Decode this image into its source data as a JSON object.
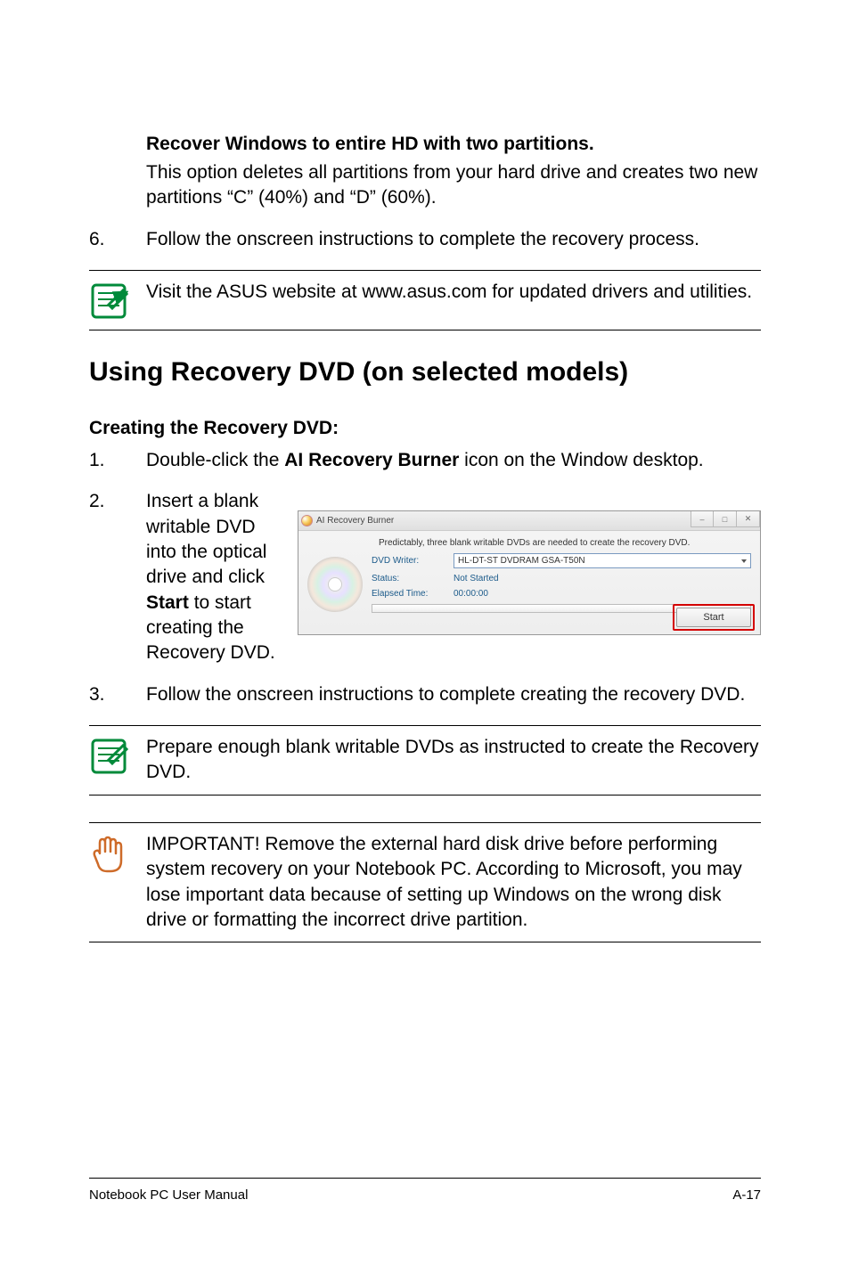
{
  "section1": {
    "heading": "Recover Windows to entire HD with two partitions.",
    "body": "This option deletes all partitions from your hard drive and creates two new partitions “C” (40%) and “D” (60%)."
  },
  "step6": {
    "num": "6.",
    "text": "Follow the onscreen instructions to complete the recovery process."
  },
  "note1": {
    "text": "Visit the ASUS website at www.asus.com for updated drivers and utilities."
  },
  "h2": "Using Recovery DVD (on selected models)",
  "h3": "Creating the Recovery DVD:",
  "step1": {
    "num": "1.",
    "pre": "Double-click the ",
    "bold": "AI Recovery Burner",
    "post": " icon on the Window desktop."
  },
  "step2": {
    "num": "2.",
    "pre": "Insert a blank writable DVD into the optical drive and click ",
    "bold": "Start",
    "post": " to start creating the Recovery DVD."
  },
  "app": {
    "title": "AI Recovery Burner",
    "msg": "Predictably, three blank writable DVDs are needed to create the recovery DVD.",
    "writer_label": "DVD Writer:",
    "writer_value": "HL-DT-ST DVDRAM GSA-T50N",
    "status_label": "Status:",
    "status_value": "Not Started",
    "elapsed_label": "Elapsed Time:",
    "elapsed_value": "00:00:00",
    "start_btn": "Start",
    "win_min": "–",
    "win_max": "□",
    "win_close": "✕"
  },
  "step3": {
    "num": "3.",
    "text": "Follow the onscreen instructions to complete creating the recovery DVD."
  },
  "note2": {
    "text": "Prepare enough blank writable DVDs as instructed to create the Recovery DVD."
  },
  "important": {
    "text": "IMPORTANT! Remove the external hard disk drive before performing system recovery on your Notebook PC. According to Microsoft, you may lose important data because of setting up Windows on the wrong disk drive or formatting the incorrect drive partition."
  },
  "footer": {
    "left": "Notebook PC User Manual",
    "right": "A-17"
  },
  "chart_data": {
    "type": "table",
    "title": "AI Recovery Burner status",
    "rows": [
      {
        "field": "DVD Writer",
        "value": "HL-DT-ST DVDRAM GSA-T50N"
      },
      {
        "field": "Status",
        "value": "Not Started"
      },
      {
        "field": "Elapsed Time",
        "value": "00:00:00"
      }
    ],
    "note": "Predictably, three blank writable DVDs are needed to create the recovery DVD."
  }
}
